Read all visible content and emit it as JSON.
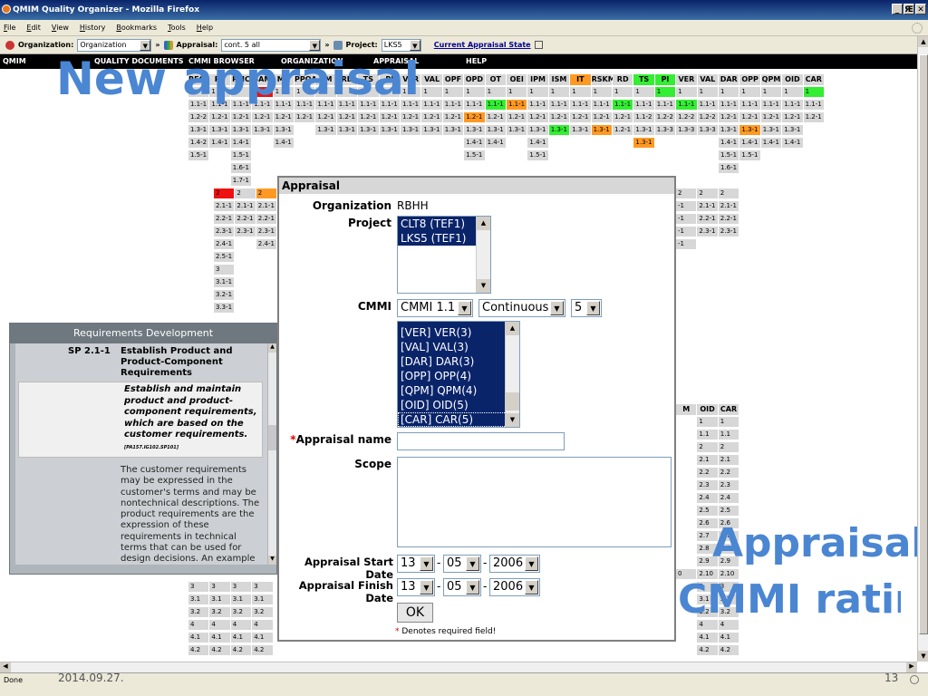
{
  "window": {
    "title": "QMIM Quality Organizer - Mozilla Firefox",
    "buttons": [
      "_",
      "Ԙ",
      "✕"
    ]
  },
  "menu": [
    "File",
    "Edit",
    "View",
    "History",
    "Bookmarks",
    "Tools",
    "Help"
  ],
  "toolbar": {
    "org_label": "Organization:",
    "org_value": "Organization",
    "appraisal_label": "Appraisal:",
    "appraisal_value": "cont. 5 all",
    "project_label": "Project:",
    "project_value": "LKS5",
    "current_state_link": "Current Appraisal State"
  },
  "nav": {
    "left": "QMIM",
    "items": [
      "QUALITY DOCUMENTS",
      "CMMI BROWSER",
      "ORGANIZATION",
      "APPRAISAL",
      "HELP"
    ]
  },
  "overlay": {
    "new_appraisal": "New appraisal",
    "appraisal_line": "Appraisal",
    "cmmi_line": "CMMI rating"
  },
  "grid": {
    "headers": [
      "REQM",
      "PP",
      "PMC",
      "SAM",
      "MA",
      "PPQA",
      "CM",
      "RD",
      "TS",
      "PI",
      "VER",
      "VAL",
      "OPF",
      "OPD",
      "OT",
      "OEI",
      "IPM",
      "ISM",
      "IT",
      "RSKM",
      "RD",
      "TS",
      "PI",
      "VER",
      "VAL",
      "DAR",
      "OPP",
      "QPM",
      "OID",
      "CAR"
    ],
    "header_colors": [
      "",
      "",
      "",
      "",
      "",
      "",
      "",
      "",
      "",
      "",
      "",
      "",
      "",
      "",
      "",
      "",
      "",
      "",
      "a",
      "",
      "",
      "g",
      "g",
      "",
      "",
      "",
      "",
      "",
      "",
      ""
    ],
    "rows": [
      [
        "1",
        "1",
        "1",
        "1",
        "1",
        "1",
        "1",
        "1",
        "1",
        "1",
        "1",
        "1",
        "1",
        "1",
        "1",
        "1",
        "1",
        "1",
        "1",
        "1",
        "1",
        "1",
        "1",
        "1",
        "1",
        "1",
        "1",
        "1",
        "1",
        "1"
      ],
      [
        "1.1-1",
        "1.1-1",
        "1.1-1",
        "1.1-1",
        "1.1-1",
        "1.1-1",
        "1.1-1",
        "1.1-1",
        "1.1-1",
        "1.1-1",
        "1.1-1",
        "1.1-1",
        "1.1-1",
        "1.1-1",
        "1.1-1",
        "1.1-1",
        "1.1-1",
        "1.1-1",
        "1.1-1",
        "1.1-1",
        "1.1-1",
        "1.1-1",
        "1.1-1",
        "1.1-1",
        "1.1-1",
        "1.1-1",
        "1.1-1",
        "1.1-1",
        "1.1-1",
        "1.1-1"
      ],
      [
        "1.2-2",
        "1.2-1",
        "1.2-1",
        "1.2-1",
        "1.2-1",
        "1.2-1",
        "1.2-1",
        "1.2-1",
        "1.2-1",
        "1.2-1",
        "1.2-1",
        "1.2-1",
        "1.2-1",
        "1.2-1",
        "1.2-1",
        "1.2-1",
        "1.2-1",
        "1.2-1",
        "1.2-1",
        "1.2-1",
        "1.2-1",
        "1.1-2",
        "1.2-2",
        "1.2-2",
        "1.2-2",
        "1.2-1",
        "1.2-1",
        "1.2-1",
        "1.2-1",
        "1.2-1"
      ],
      [
        "1.3-1",
        "1.3-1",
        "1.3-1",
        "1.3-1",
        "1.3-1",
        "",
        "1.3-1",
        "1.3-1",
        "1.3-1",
        "1.3-1",
        "1.3-1",
        "1.3-1",
        "1.3-1",
        "1.3-1",
        "1.3-1",
        "1.3-1",
        "1.3-1",
        "1.3-1",
        "1.3-1",
        "1.3-1",
        "1.2-1",
        "1.3-1",
        "1.3-3",
        "1.3-3",
        "1.3-3",
        "1.3-1",
        "1.3-1",
        "1.3-1",
        "1.3-1",
        ""
      ],
      [
        "1.4-2",
        "1.4-1",
        "1.4-1",
        "",
        "1.4-1",
        "",
        "",
        "",
        "",
        "",
        "",
        "",
        "",
        "1.4-1",
        "1.4-1",
        "",
        "1.4-1",
        "",
        "",
        "",
        "",
        "1.3-1",
        "",
        "",
        "",
        "1.4-1",
        "1.4-1",
        "1.4-1",
        "1.4-1",
        ""
      ],
      [
        "1.5-1",
        "",
        "1.5-1",
        "",
        "",
        "",
        "",
        "",
        "",
        "",
        "",
        "",
        "",
        "1.5-1",
        "",
        "",
        "1.5-1",
        "",
        "",
        "",
        "",
        "",
        "",
        "",
        "",
        "1.5-1",
        "1.5-1",
        "",
        "",
        ""
      ],
      [
        "",
        "",
        "1.6-1",
        "",
        "",
        "",
        "",
        "",
        "",
        "",
        "",
        "",
        "",
        "",
        "",
        "",
        "",
        "",
        "",
        "",
        "",
        "",
        "",
        "",
        "",
        "1.6-1",
        "",
        "",
        "",
        ""
      ]
    ],
    "row7": [
      "",
      "",
      "1.7-1"
    ],
    "level2_rows": [
      [
        "2",
        "2",
        "2",
        "2"
      ],
      [
        "2.1-1",
        "2.1-1",
        "2.1-1",
        ""
      ],
      [
        "2.2-1",
        "2.2-1",
        "2.2-1",
        ""
      ],
      [
        "2.3-1",
        "2.3-1",
        "2.3-1",
        ""
      ],
      [
        "2.4-1",
        "",
        "2.4-1",
        ""
      ],
      [
        "2.5-1",
        "",
        "",
        ""
      ],
      [
        "3",
        "",
        "",
        ""
      ],
      [
        "3.1-1",
        "",
        "",
        ""
      ],
      [
        "3.2-1",
        "",
        "",
        ""
      ],
      [
        "3.3-1",
        "",
        "",
        ""
      ]
    ],
    "right_frag": [
      [
        "2",
        "2",
        "2"
      ],
      [
        "-1",
        "2.1-1",
        "2.1-1"
      ],
      [
        "-1",
        "2.2-1",
        "2.2-1"
      ],
      [
        "-1",
        "2.3-1",
        "2.3-1"
      ],
      [
        "-1",
        "",
        ""
      ]
    ],
    "right_headers": [
      "M",
      "OID",
      "CAR"
    ],
    "right_cells": [
      [
        "",
        "1",
        "1"
      ],
      [
        "",
        "1.1",
        "1.1"
      ],
      [
        "",
        "2",
        "2"
      ],
      [
        "",
        "2.1",
        "2.1"
      ],
      [
        "",
        "2.2",
        "2.2"
      ],
      [
        "",
        "2.3",
        "2.3"
      ],
      [
        "",
        "2.4",
        "2.4"
      ],
      [
        "",
        "2.5",
        "2.5"
      ],
      [
        "",
        "2.6",
        "2.6"
      ],
      [
        "",
        "2.7",
        "2.7"
      ],
      [
        "",
        "2.8",
        "2.8"
      ],
      [
        "",
        "2.9",
        "2.9"
      ],
      [
        "0",
        "2.10",
        "2.10"
      ],
      [
        "",
        "3",
        "3"
      ],
      [
        "",
        "3.1",
        "3.1"
      ],
      [
        "",
        "3.2",
        "3.2"
      ],
      [
        "",
        "4",
        "4"
      ],
      [
        "",
        "4.1",
        "4.1"
      ],
      [
        "",
        "4.2",
        "4.2"
      ]
    ],
    "bottom_left": [
      [
        "3",
        "3",
        "3",
        "3"
      ],
      [
        "3.1",
        "3.1",
        "3.1",
        "3.1"
      ],
      [
        "3.2",
        "3.2",
        "3.2",
        "3.2"
      ],
      [
        "4",
        "4",
        "4",
        "4"
      ],
      [
        "4.1",
        "4.1",
        "4.1",
        "4.1"
      ],
      [
        "4.2",
        "4.2",
        "4.2",
        "4.2"
      ]
    ]
  },
  "req_panel": {
    "title": "Requirements Development",
    "sp_id": "SP 2.1-1",
    "sp_title": "Establish Product and Product-Component Requirements",
    "quote": "Establish and maintain product and product-component requirements, which are based on the customer requirements.",
    "quote_ref": "[PA157.IG102.SP101]",
    "body": "The customer requirements may be expressed in the customer's terms and may be nontechnical descriptions. The product requirements are the expression of these requirements in technical terms that can be used for design decisions. An example of this translation is found in the first"
  },
  "dialog": {
    "title": "Appraisal",
    "org_label": "Organization",
    "org_value": "RBHH",
    "project_label": "Project",
    "projects": [
      "CLT8 (TEF1)",
      "LKS5 (TEF1)"
    ],
    "cmmi_label": "CMMI",
    "cmmi_model": "CMMI 1.1",
    "cmmi_rep": "Continuous",
    "cmmi_level": "5",
    "process_areas": [
      "[VER] VER(3)",
      "[VAL] VAL(3)",
      "[DAR] DAR(3)",
      "[OPP] OPP(4)",
      "[QPM] QPM(4)",
      "[OID] OID(5)",
      "[CAR] CAR(5)"
    ],
    "name_label": "Appraisal name",
    "required_mark": "*",
    "scope_label": "Scope",
    "start_label": "Appraisal Start Date",
    "finish_label": "Appraisal Finish Date",
    "start": {
      "day": "13",
      "month": "05",
      "year": "2006"
    },
    "finish": {
      "day": "13",
      "month": "05",
      "year": "2006"
    },
    "date_sep": "-",
    "ok_label": "OK",
    "required_note": "Denotes required field!"
  },
  "status": {
    "left": "Done",
    "date": "2014.09.27.",
    "page": "13"
  }
}
